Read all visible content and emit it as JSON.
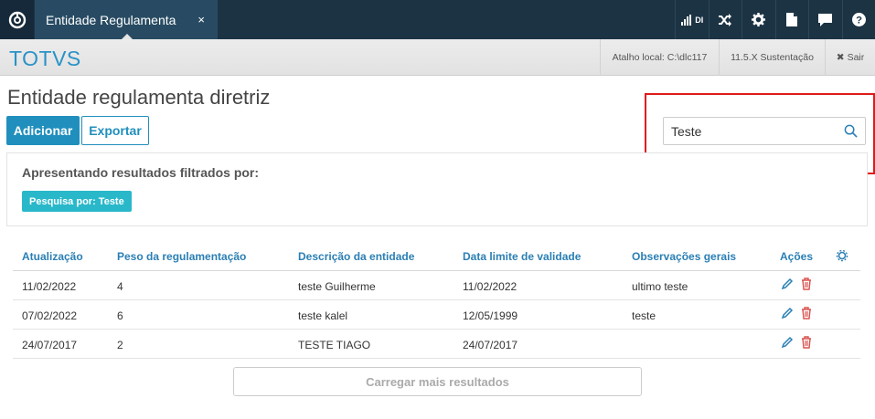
{
  "tab": {
    "label": "Entidade Regulamenta",
    "close": "×"
  },
  "top_icons": [
    {
      "name": "signal-di-icon",
      "label": "DI"
    },
    {
      "name": "shuffle-icon"
    },
    {
      "name": "gear-icon"
    },
    {
      "name": "document-icon"
    },
    {
      "name": "chat-icon"
    },
    {
      "name": "help-icon"
    }
  ],
  "header": {
    "brand": "TOTVS",
    "shortcut": "Atalho local: C:\\dlc117",
    "version": "11.5.X Sustentação",
    "logout": "Sair"
  },
  "page": {
    "title": "Entidade regulamenta diretriz",
    "add_label": "Adicionar",
    "export_label": "Exportar"
  },
  "search": {
    "value": "Teste",
    "placeholder": ""
  },
  "filter": {
    "title": "Apresentando resultados filtrados por:",
    "tag": "Pesquisa por: Teste"
  },
  "table": {
    "columns": [
      "Atualização",
      "Peso da regulamentação",
      "Descrição da entidade",
      "Data limite de validade",
      "Observações gerais",
      "Ações"
    ],
    "rows": [
      [
        "11/02/2022",
        "4",
        "teste Guilherme",
        "11/02/2022",
        "ultimo teste"
      ],
      [
        "07/02/2022",
        "6",
        "teste kalel",
        "12/05/1999",
        "teste"
      ],
      [
        "24/07/2017",
        "2",
        "TESTE TIAGO",
        "24/07/2017",
        ""
      ]
    ]
  },
  "load_more": "Carregar mais resultados",
  "colors": {
    "primary": "#208fbd",
    "topbar": "#1c3344",
    "tab": "#284b63",
    "tag": "#29b8ca",
    "delete": "#d9534f",
    "highlight": "#e01a1a"
  }
}
